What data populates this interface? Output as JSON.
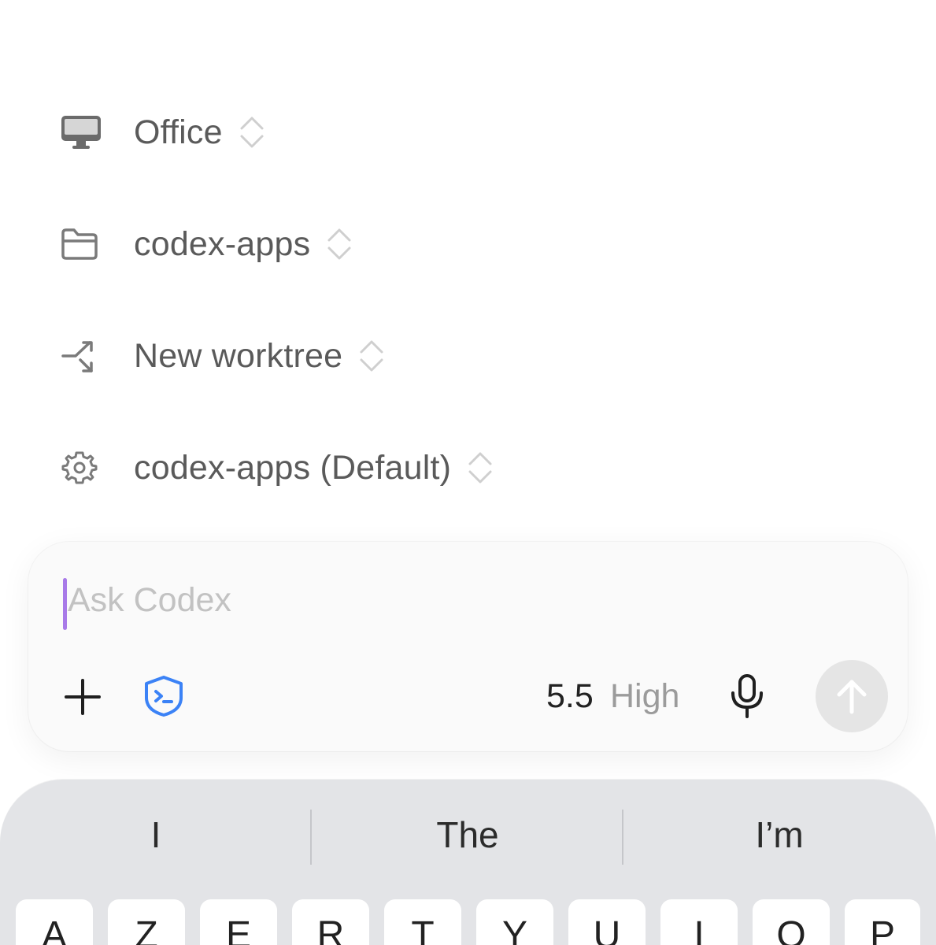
{
  "settings": {
    "items": [
      {
        "label": "Office",
        "icon": "desktop-icon"
      },
      {
        "label": "codex-apps",
        "icon": "folder-icon"
      },
      {
        "label": "New worktree",
        "icon": "branch-icon"
      },
      {
        "label": "codex-apps (Default)",
        "icon": "gear-icon"
      }
    ]
  },
  "composer": {
    "placeholder": "Ask Codex",
    "model": "5.5",
    "effort": "High",
    "icons": [
      "plus-icon",
      "shield-terminal-icon",
      "microphone-icon",
      "arrow-up-icon"
    ],
    "accent_color": "#a87ae8",
    "shield_color": "#3b82f6"
  },
  "keyboard": {
    "suggestions": [
      "I",
      "The",
      "I’m"
    ],
    "keys": [
      "A",
      "Z",
      "E",
      "R",
      "T",
      "Y",
      "U",
      "I",
      "O",
      "P"
    ]
  }
}
